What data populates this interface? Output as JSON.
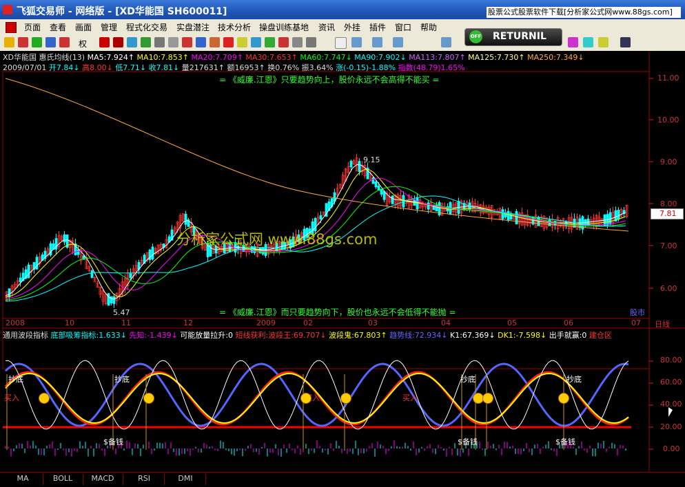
{
  "window": {
    "title": "飞狐交易师 - 网络版 - [XD华能国 SH600011]",
    "ad_text": "股票公式股票软件下载[分析家公式网www.88gs.com]"
  },
  "menu": [
    "页面",
    "查看",
    "画面",
    "管理",
    "程式化交易",
    "实盘潜注",
    "技术分析",
    "操盘训练基地",
    "资讯",
    "外挂",
    "插件",
    "窗口",
    "帮助"
  ],
  "returnil": {
    "badge": "OFF",
    "label": "RETURNIL"
  },
  "toolbar": {
    "quan_label": "权"
  },
  "main_chart": {
    "ma_line": [
      "XD华能国",
      "惠氏均线(13)",
      "MA5:7.924↑",
      "MA10:7.853↑",
      "MA20:7.709↑",
      "MA30:7.653↑",
      "MA60:7.747↓",
      "MA90:7.902↓",
      "MA113:7.807↑",
      "MA125:7.730↑",
      "MA250:7.349↓"
    ],
    "ohlc_line": [
      "2009/07/01",
      "开7.84↓",
      "高8.00↓",
      "低7.71↓",
      "收7.81↓",
      "量217631↑",
      "额16953↑",
      "换0.76%",
      "振3.64%",
      "涨(-0.15)-1.88%",
      "指数(48.79)1.65%"
    ],
    "slogan_top": "=  《威廉.江恩》只要趋势向上，股价永远不会高得不能买  =",
    "slogan_bottom": "=  《威廉.江恩》而只要趋势向下，股价也永远不会低得不能抛  =",
    "watermark": "分析家公式网 www.88gs.com",
    "high_label": "9.15",
    "low_label": "5.47",
    "price_tag": "7.81",
    "market_label": "股市",
    "y_ticks": [
      "11.00",
      "10.00",
      "9.00",
      "8.00",
      "7.00",
      "6.00"
    ],
    "x_ticks": [
      "2008",
      "10",
      "11",
      "12",
      "2009",
      "02",
      "03",
      "04",
      "05",
      "06",
      "07"
    ],
    "x_end_label": "日线"
  },
  "indicator_panel": {
    "header": [
      "通用波段指标",
      "底部吸筹指标:1.633↓",
      "先知:-1.439↓",
      "可能放量拉升:0",
      "短线获利:波段王:69.707↓",
      "波段鬼:67.803↑",
      "趋势线:72.934↓",
      "K1:67.369↓",
      "DK1:-7.598↓",
      "出手就赢:0",
      "建仓区"
    ],
    "y_ticks": [
      "80.00",
      "60.00",
      "40.00",
      "20.00",
      "0.00"
    ],
    "labels": {
      "chaodi": "抄底",
      "mairu": "买入",
      "beiqian": "$备钱"
    }
  },
  "tabs": [
    "MA",
    "BOLL",
    "MACD",
    "RSI",
    "DMI"
  ],
  "colors": {
    "up": "#ff3333",
    "down": "#00ffff",
    "ma5": "#ffffff",
    "ma10": "#ffff00",
    "ma20": "#ff00ff",
    "ma30": "#00ff00",
    "ma60": "#ff9900",
    "ma250": "#ffaa44",
    "axis": "#cc2222",
    "slogan": "#33ff33"
  }
}
